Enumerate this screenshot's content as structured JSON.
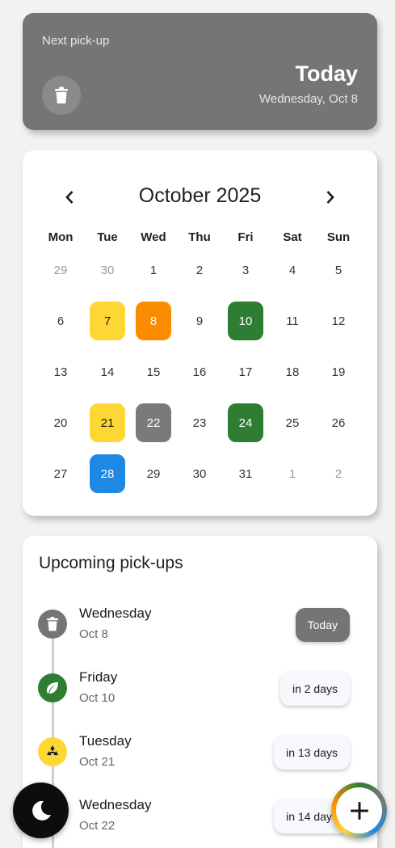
{
  "next_pickup": {
    "label": "Next pick-up",
    "when": "Today",
    "date": "Wednesday, Oct 8",
    "icon": "trash-icon",
    "color": "#757575"
  },
  "calendar": {
    "month_title": "October 2025",
    "weekdays": [
      "Mon",
      "Tue",
      "Wed",
      "Thu",
      "Fri",
      "Sat",
      "Sun"
    ],
    "weeks": [
      [
        {
          "d": "29",
          "muted": true
        },
        {
          "d": "30",
          "muted": true
        },
        {
          "d": "1"
        },
        {
          "d": "2"
        },
        {
          "d": "3"
        },
        {
          "d": "4"
        },
        {
          "d": "5"
        }
      ],
      [
        {
          "d": "6"
        },
        {
          "d": "7",
          "color": "#fdd835",
          "dark": true
        },
        {
          "d": "8",
          "color": "#fb8c00"
        },
        {
          "d": "9"
        },
        {
          "d": "10",
          "color": "#2e7d32"
        },
        {
          "d": "11"
        },
        {
          "d": "12"
        }
      ],
      [
        {
          "d": "13"
        },
        {
          "d": "14"
        },
        {
          "d": "15"
        },
        {
          "d": "16"
        },
        {
          "d": "17"
        },
        {
          "d": "18"
        },
        {
          "d": "19"
        }
      ],
      [
        {
          "d": "20"
        },
        {
          "d": "21",
          "color": "#fdd835",
          "dark": true
        },
        {
          "d": "22",
          "color": "#7a7a7a"
        },
        {
          "d": "23"
        },
        {
          "d": "24",
          "color": "#2e7d32"
        },
        {
          "d": "25"
        },
        {
          "d": "26"
        }
      ],
      [
        {
          "d": "27"
        },
        {
          "d": "28",
          "color": "#1e88e5"
        },
        {
          "d": "29"
        },
        {
          "d": "30"
        },
        {
          "d": "31"
        },
        {
          "d": "1",
          "muted": true
        },
        {
          "d": "2",
          "muted": true
        }
      ]
    ]
  },
  "upcoming": {
    "title": "Upcoming pick-ups",
    "items": [
      {
        "day": "Wednesday",
        "date": "Oct 8",
        "badge": "Today",
        "icon": "trash-icon",
        "color": "#757575",
        "now": true
      },
      {
        "day": "Friday",
        "date": "Oct 10",
        "badge": "in 2 days",
        "icon": "leaf-icon",
        "color": "#2e7d32"
      },
      {
        "day": "Tuesday",
        "date": "Oct 21",
        "badge": "in 13 days",
        "icon": "recycle-icon",
        "color": "#fdd835"
      },
      {
        "day": "Wednesday",
        "date": "Oct 22",
        "badge": "in 14 days",
        "icon": "trash-icon",
        "color": "#757575"
      }
    ]
  },
  "buttons": {
    "theme_icon": "moon-icon",
    "add_icon": "plus-icon"
  }
}
